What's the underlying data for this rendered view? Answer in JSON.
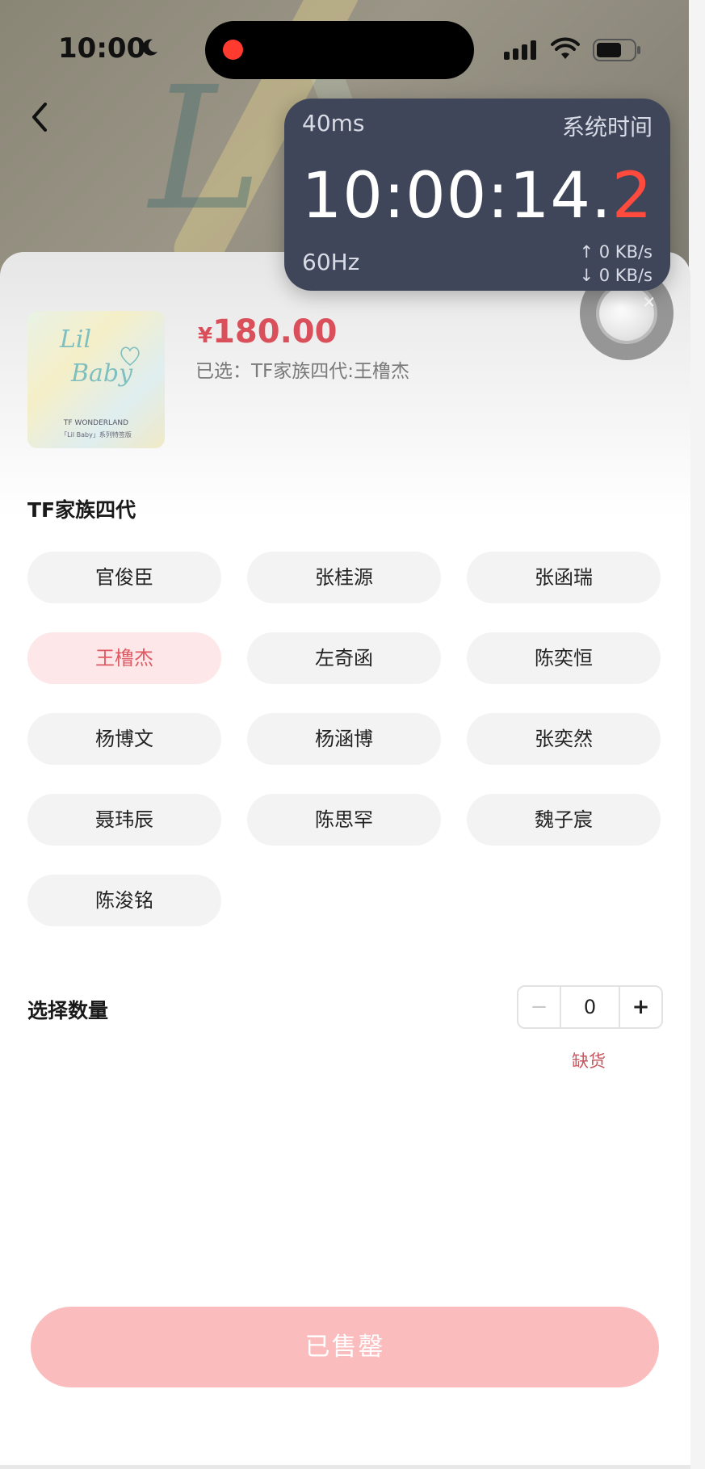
{
  "status_bar": {
    "time": "10:00"
  },
  "timer_overlay": {
    "latency": "40ms",
    "label": "系统时间",
    "clock_main": "10:00:14.",
    "clock_tenth": "2",
    "refresh_rate": "60Hz",
    "upload": "↑ 0 KB/s",
    "download": "↓ 0 KB/s",
    "accent_color": "#ff4b3e"
  },
  "product": {
    "image_text": {
      "line1": "Lil",
      "line2": "Baby",
      "tag1": "TF WONDERLAND",
      "tag2": "「Lil Baby」系列特签版"
    },
    "currency": "¥",
    "price": "180.00",
    "selected": "已选：TF家族四代:王橹杰",
    "price_color": "#d94f5a"
  },
  "variants": {
    "title": "TF家族四代",
    "options": [
      {
        "label": "官俊臣",
        "active": false
      },
      {
        "label": "张桂源",
        "active": false
      },
      {
        "label": "张函瑞",
        "active": false
      },
      {
        "label": "王橹杰",
        "active": true
      },
      {
        "label": "左奇函",
        "active": false
      },
      {
        "label": "陈奕恒",
        "active": false
      },
      {
        "label": "杨博文",
        "active": false
      },
      {
        "label": "杨涵博",
        "active": false
      },
      {
        "label": "张奕然",
        "active": false
      },
      {
        "label": "聂玮辰",
        "active": false
      },
      {
        "label": "陈思罕",
        "active": false
      },
      {
        "label": "魏子宸",
        "active": false
      },
      {
        "label": "陈浚铭",
        "active": false
      }
    ]
  },
  "quantity": {
    "label": "选择数量",
    "minus": "−",
    "value": "0",
    "plus": "+",
    "stock_status": "缺货"
  },
  "buy_button": {
    "label": "已售罄",
    "color": "#fbbcbd"
  }
}
